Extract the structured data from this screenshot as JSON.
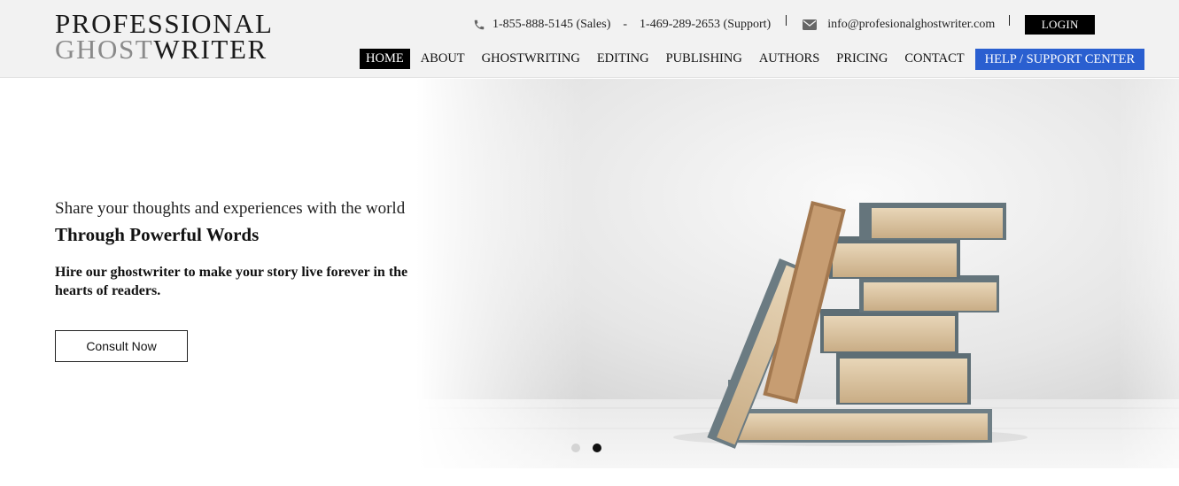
{
  "logo": {
    "line1": "PROFESSIONAL",
    "line2_a": "GHOST",
    "line2_b": "WRITER"
  },
  "topbar": {
    "sales_phone": "1-855-888-5145 (Sales)",
    "dash": "-",
    "support_phone": "1-469-289-2653 (Support)",
    "email": "info@profesionalghostwriter.com",
    "login_label": "LOGIN"
  },
  "nav": {
    "items": [
      "HOME",
      "ABOUT",
      "GHOSTWRITING",
      "EDITING",
      "PUBLISHING",
      "AUTHORS",
      "PRICING",
      "CONTACT"
    ],
    "help_label": "HELP / SUPPORT CENTER",
    "active_index": 0
  },
  "hero": {
    "tagline": "Share your thoughts and experiences with the world",
    "headline": "Through Powerful Words",
    "subline": "Hire our ghostwriter to make your story live forever in the hearts of readers.",
    "cta_label": "Consult Now",
    "slider": {
      "slide_count": 2,
      "active_slide": 2
    }
  },
  "colors": {
    "help_button": "#2a5fd0",
    "login_button": "#000000",
    "header_bg": "#f2f2f2"
  },
  "icons": {
    "phone": "phone-icon",
    "email": "envelope-icon"
  }
}
